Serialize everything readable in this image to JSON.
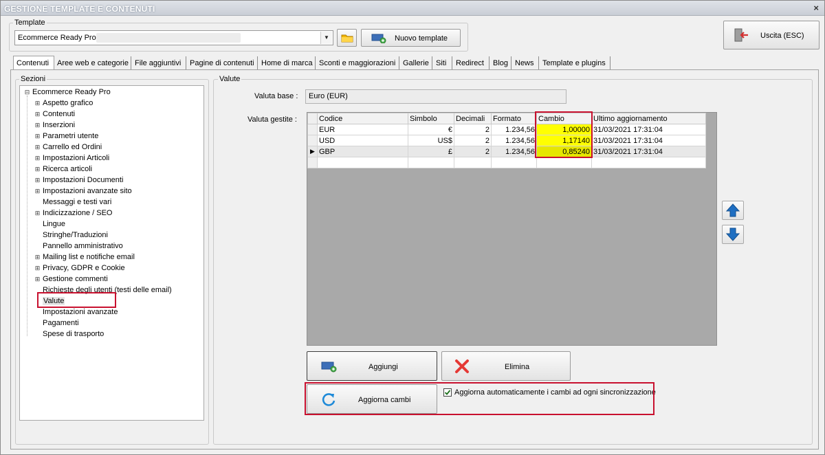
{
  "window": {
    "title": "GESTIONE TEMPLATE E CONTENUTI",
    "close": "×"
  },
  "template": {
    "group_label": "Template",
    "selected": "Ecommerce Ready Pro (",
    "new_template_label": "Nuovo template"
  },
  "exit_button": {
    "label": "Uscita (ESC)"
  },
  "tabs": [
    {
      "label": "Contenuti",
      "active": true
    },
    {
      "label": "Aree web e categorie"
    },
    {
      "label": "File aggiuntivi"
    },
    {
      "label": "Pagine di contenuti"
    },
    {
      "label": "Home di marca"
    },
    {
      "label": "Sconti e maggiorazioni"
    },
    {
      "label": "Gallerie"
    },
    {
      "label": "Siti"
    },
    {
      "label": "Redirect"
    },
    {
      "label": "Blog"
    },
    {
      "label": "News"
    },
    {
      "label": "Template e plugins"
    }
  ],
  "sections": {
    "group_label": "Sezioni",
    "root": "Ecommerce Ready Pro",
    "items": [
      {
        "label": "Aspetto grafico",
        "expandable": true
      },
      {
        "label": "Contenuti",
        "expandable": true
      },
      {
        "label": "Inserzioni",
        "expandable": true
      },
      {
        "label": "Parametri utente",
        "expandable": true
      },
      {
        "label": "Carrello ed Ordini",
        "expandable": true
      },
      {
        "label": "Impostazioni Articoli",
        "expandable": true
      },
      {
        "label": "Ricerca articoli",
        "expandable": true
      },
      {
        "label": "Impostazioni Documenti",
        "expandable": true
      },
      {
        "label": "Impostazioni avanzate sito",
        "expandable": true
      },
      {
        "label": "Messaggi e testi vari",
        "expandable": false
      },
      {
        "label": "Indicizzazione / SEO",
        "expandable": true
      },
      {
        "label": "Lingue",
        "expandable": false
      },
      {
        "label": "Stringhe/Traduzioni",
        "expandable": false
      },
      {
        "label": "Pannello amministrativo",
        "expandable": false
      },
      {
        "label": "Mailing list e notifiche email",
        "expandable": true
      },
      {
        "label": "Privacy, GDPR e Cookie",
        "expandable": true
      },
      {
        "label": "Gestione commenti",
        "expandable": true
      },
      {
        "label": "Richieste degli utenti (testi delle email)",
        "expandable": false
      },
      {
        "label": "Valute",
        "expandable": false,
        "selected": true
      },
      {
        "label": "Impostazioni avanzate",
        "expandable": false
      },
      {
        "label": "Pagamenti",
        "expandable": false
      },
      {
        "label": "Spese di trasporto",
        "expandable": false
      }
    ]
  },
  "valute": {
    "group_label": "Valute",
    "base_label": "Valuta base :",
    "base_value": "Euro (EUR)",
    "managed_label": "Valuta gestite :",
    "columns": [
      "Codice",
      "Simbolo",
      "Decimali",
      "Formato",
      "Cambio",
      "Ultimo aggiornamento"
    ],
    "rows": [
      {
        "code": "EUR",
        "symbol": "€",
        "decimals": "2",
        "format": "1.234,56",
        "rate": "1,00000",
        "updated": "31/03/2021 17:31:04"
      },
      {
        "code": "USD",
        "symbol": "US$",
        "decimals": "2",
        "format": "1.234,56",
        "rate": "1,17140",
        "updated": "31/03/2021 17:31:04"
      },
      {
        "code": "GBP",
        "symbol": "£",
        "decimals": "2",
        "format": "1.234,56",
        "rate": "0,85240",
        "updated": "31/03/2021 17:31:04",
        "current": true
      }
    ],
    "add_label": "Aggiungi",
    "delete_label": "Elimina",
    "update_label": "Aggiorna cambi",
    "auto_update_label": "Aggiorna automaticamente i cambi ad ogni sincronizzazione",
    "auto_update_checked": true
  },
  "colors": {
    "highlight": "#c8102e",
    "rate_cell": "#ffff00",
    "arrow_blue": "#1f6fc2"
  }
}
